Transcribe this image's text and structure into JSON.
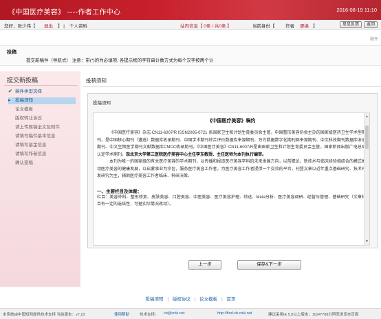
{
  "header": {
    "title": "《中国医疗美容》 ----作者工作中心",
    "datetime": "2016-08-19 11:10"
  },
  "userbar": {
    "greeting": "您好，张少伟【",
    "logout": "退出",
    "sep1": "】 |",
    "profile": "个人资料",
    "messages": "站内信息【 0条 / 共0条 】",
    "identity_label": "当前身份【",
    "identity": "作者",
    "change": "更换",
    "identity_end": "】",
    "feedback_button": "意见反馈",
    "back_button": "返回"
  },
  "crumb_right": "稿件",
  "section": {
    "heading": "投稿",
    "subheading": "提交新稿件（导航式）  注意：带(*)的为必填项, 各提示框的字符串计数方式为每个汉字按两个计"
  },
  "left_panel": {
    "title": "提交新投稿",
    "steps": [
      {
        "label": "稿件类型选择",
        "state": "done",
        "icon": "✔"
      },
      {
        "label": "投稿须知",
        "state": "active",
        "icon": "▸"
      },
      {
        "label": "论文模板",
        "state": "pending",
        "icon": ""
      },
      {
        "label": "版权转让协议",
        "state": "pending",
        "icon": ""
      },
      {
        "label": "请上传原稿全文及附件",
        "state": "pending",
        "icon": ""
      },
      {
        "label": "请填写稿件基本信息",
        "state": "pending",
        "icon": ""
      },
      {
        "label": "请填写基金信息",
        "state": "pending",
        "icon": ""
      },
      {
        "label": "请填写作者信息",
        "state": "pending",
        "icon": ""
      },
      {
        "label": "确认投稿",
        "state": "pending",
        "icon": ""
      }
    ]
  },
  "main": {
    "title": "投稿须知",
    "panel_header": "投稿须知",
    "doc_title": "《中国医疗美容》稿约",
    "para1": "《中国医疗美容》杂志  CN11-6007/R ISSN2095-0721  系国家卫生和计划生育委员会主管，中国整形美容协会主办的国家级医药卫生学术型期刊，是中国核心期刊（遴选）数据库收录期刊、中国学术期刊综合评价数据库来源期刊、万方数据数字化期刊群来源期刊、中文科技期刊数据库收录期刊、中文生物医学期刊文献数据库CMCC收录期刊。《中国医疗美容》CN11-6007/R是由国家卫生和计划生育委员会主管，国家新闻出版广电总局认定学术期刊。",
    "para1_bold": "现北京大学第三医院医疗美容中心主任李东教授、主任医师为本刊执行编审。",
    "para2": "本刊为唯一的国家级的有关医疗美容的学术期刊，以传播和报道医疗美容学科的未来发展方向，以前瞻论、新技术与临床经验相结合的模式推动医疗美容的健康发展，以启蒙事业为宗旨，服务医疗美容工作者，为医疗美容工作者提供一个交流的平台，刊登文章以近年重点基础研究、技术开发研究为主，辅助医疗美容工作者临床、科研决策。",
    "section_title": "一、主要栏目及体裁：",
    "para3": "栏目：美容外科、整形修复、皮肤美容、口腔美容、中医美容、医疗美容护理、综述、Meta分析、医疗美容调研、经营与管理、基础研究（文章栏目有一定的选结性，可据实际情况改动）。",
    "prev_button": "上一步",
    "next_button": "保存&下一步"
  },
  "footer": {
    "links": [
      "投稿须知",
      "版权协议",
      "论文模板",
      "首页"
    ],
    "status_left": "本系统由中国知网提供技术支持  当前版本：v7.23",
    "help": "使用帮助",
    "support_label": "技术支持：",
    "support_email": "cb@cnki.net",
    "url": "http://find.cb.cnki.net",
    "note": "建议采用IE 5.0以上版本；1024*768分辨率浏览本页面"
  },
  "colors": {
    "banner": "#c8202c",
    "accent_link": "#1a5fa8",
    "active_step": "#b9d6ef"
  }
}
